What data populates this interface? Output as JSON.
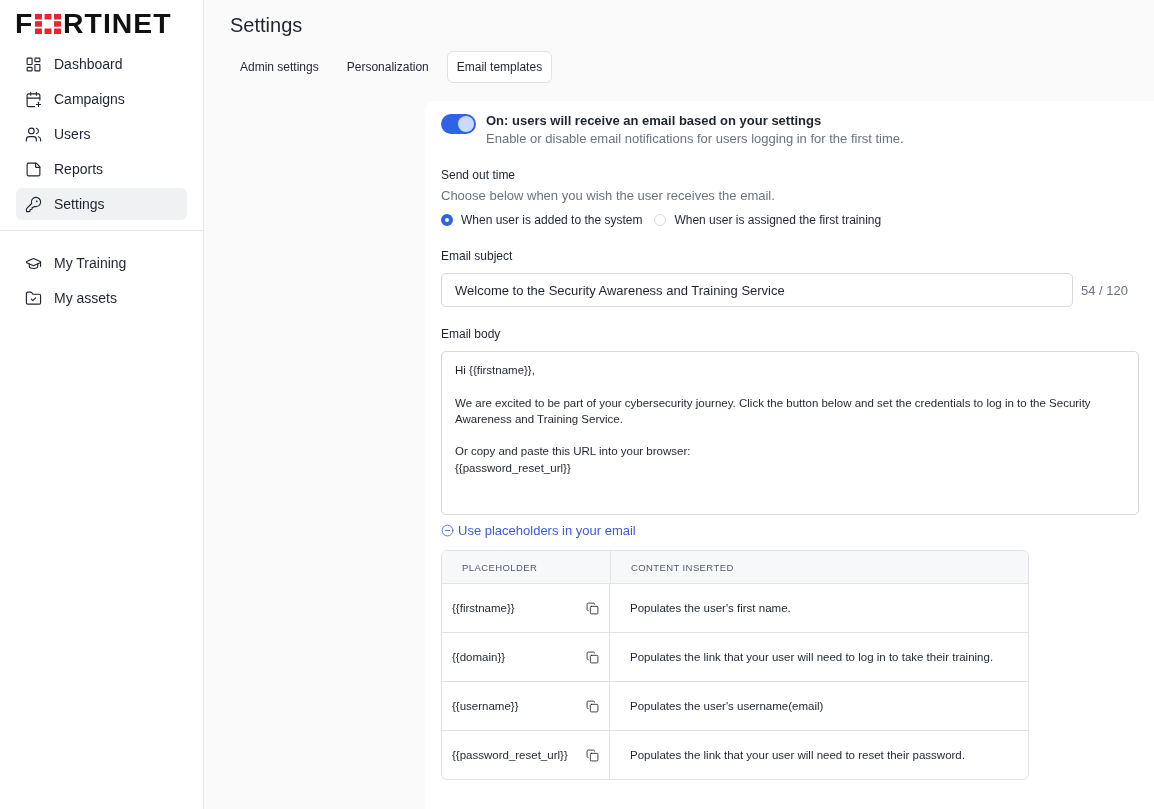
{
  "logo": {
    "text_start": "F",
    "text_end": "RTINET"
  },
  "sidebar": {
    "items": [
      {
        "label": "Dashboard",
        "kind": "dashboard",
        "selected": false
      },
      {
        "label": "Campaigns",
        "kind": "campaigns",
        "selected": false
      },
      {
        "label": "Users",
        "kind": "users",
        "selected": false
      },
      {
        "label": "Reports",
        "kind": "reports",
        "selected": false
      },
      {
        "label": "Settings",
        "kind": "settings",
        "selected": true
      }
    ],
    "secondary_items": [
      {
        "label": "My Training",
        "kind": "training",
        "selected": false
      },
      {
        "label": "My assets",
        "kind": "assets",
        "selected": false
      }
    ]
  },
  "page_title": "Settings",
  "tabs": [
    {
      "label": "Admin settings",
      "selected": false
    },
    {
      "label": "Personalization",
      "selected": false
    },
    {
      "label": "Email templates",
      "selected": true
    }
  ],
  "toggle": {
    "on": true,
    "title": "On: users will receive an email based on your settings",
    "description": "Enable or disable email notifications for users logging in for the first time."
  },
  "send_out_time": {
    "label": "Send out time",
    "hint": "Choose below when you wish the user receives the email.",
    "options": [
      {
        "label": "When user is added to the system",
        "selected": true
      },
      {
        "label": "When user is assigned the first training",
        "selected": false
      }
    ]
  },
  "email_subject": {
    "label": "Email subject",
    "value": "Welcome to the Security Awareness and Training Service",
    "counter": "54 / 120"
  },
  "email_body": {
    "label": "Email body",
    "value": "Hi {{firstname}},\n\nWe are excited to be part of your cybersecurity journey. Click the button below and set the credentials to log in to the Security Awareness and Training Service.\n\nOr copy and paste this URL into your browser:\n{{password_reset_url}}"
  },
  "placeholders": {
    "toggle_label": "Use placeholders in your email",
    "expanded": true,
    "columns": [
      "PLACEHOLDER",
      "CONTENT INSERTED"
    ],
    "rows": [
      {
        "placeholder": "{{firstname}}",
        "content": "Populates the user's first name."
      },
      {
        "placeholder": "{{domain}}",
        "content": "Populates the link that your user will need to log in to take their training."
      },
      {
        "placeholder": "{{username}}",
        "content": "Populates the user's username(email)"
      },
      {
        "placeholder": "{{password_reset_url}}",
        "content": "Populates the link that your user will need to reset their password."
      }
    ]
  }
}
